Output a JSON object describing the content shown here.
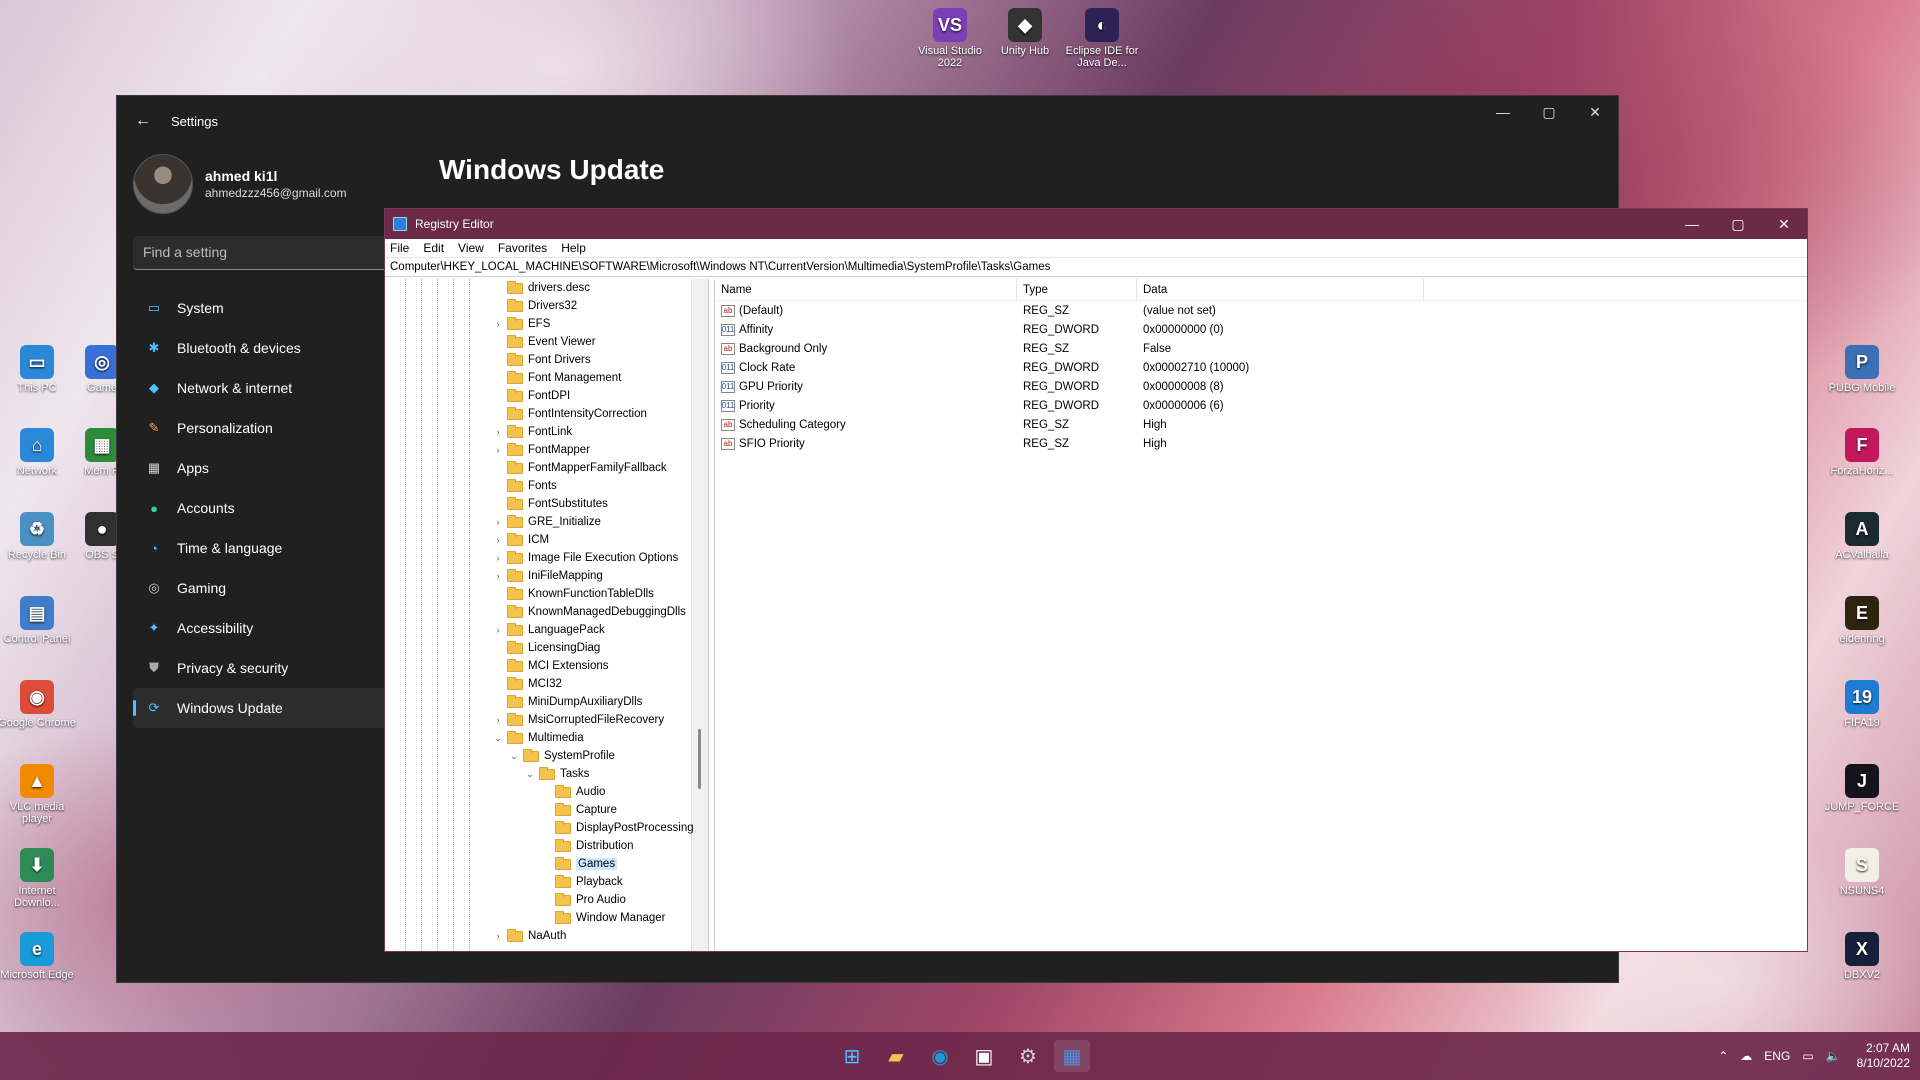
{
  "desktop": {
    "top_icons": [
      {
        "label": "Visual Studio 2022",
        "color": "#7b3fb8",
        "glyph": "VS"
      },
      {
        "label": "Unity Hub",
        "color": "#333333",
        "glyph": "◆"
      },
      {
        "label": "Eclipse IDE for Java De...",
        "color": "#2c2255",
        "glyph": "◐"
      }
    ],
    "left_icons": [
      {
        "label": "This PC",
        "color": "#2b88d8",
        "glyph": "▭"
      },
      {
        "label": "Game",
        "color": "#3a6fd8",
        "glyph": "◎"
      },
      {
        "label": "Network",
        "color": "#2b88d8",
        "glyph": "⌂"
      },
      {
        "label": "Mem R",
        "color": "#2e8b3a",
        "glyph": "▦"
      },
      {
        "label": "Recycle Bin",
        "color": "#4a90c2",
        "glyph": "♻"
      },
      {
        "label": "OBS S",
        "color": "#303030",
        "glyph": "●"
      },
      {
        "label": "Control Panel",
        "color": "#3f7cc9",
        "glyph": "▤"
      },
      {
        "label": "Google Chrome",
        "color": "#dd4b39",
        "glyph": "◉"
      },
      {
        "label": "VLC media player",
        "color": "#f08a00",
        "glyph": "▲"
      },
      {
        "label": "Internet Downlo...",
        "color": "#2e8b57",
        "glyph": "⬇"
      },
      {
        "label": "Microsoft Edge",
        "color": "#1a9bd7",
        "glyph": "e"
      }
    ],
    "right_icons": [
      {
        "label": "PUBG Mobile",
        "color": "#3b6fb6",
        "glyph": "P"
      },
      {
        "label": "ForzaHoriz...",
        "color": "#c2185b",
        "glyph": "F"
      },
      {
        "label": "ACValhalla",
        "color": "#1a2c2f",
        "glyph": "A"
      },
      {
        "label": "eldenring",
        "color": "#2d2410",
        "glyph": "E"
      },
      {
        "label": "FIFA19",
        "color": "#1f7bd1",
        "glyph": "19"
      },
      {
        "label": "JUMP_FORCE",
        "color": "#14141a",
        "glyph": "J"
      },
      {
        "label": "NSUNS4",
        "color": "#f2efe6",
        "glyph": "S"
      },
      {
        "label": "DBXV2",
        "color": "#15203a",
        "glyph": "X"
      }
    ]
  },
  "settings": {
    "title": "Settings",
    "user_name": "ahmed ki1l",
    "user_email": "ahmedzzz456@gmail.com",
    "search_placeholder": "Find a setting",
    "page_title": "Windows Update",
    "nav": [
      {
        "label": "System",
        "icon": "▭",
        "color": "#4cc2ff"
      },
      {
        "label": "Bluetooth & devices",
        "icon": "✱",
        "color": "#4cc2ff"
      },
      {
        "label": "Network & internet",
        "icon": "◆",
        "color": "#4cc2ff"
      },
      {
        "label": "Personalization",
        "icon": "✎",
        "color": "#e8a46b"
      },
      {
        "label": "Apps",
        "icon": "▦",
        "color": "#cfcfcf"
      },
      {
        "label": "Accounts",
        "icon": "●",
        "color": "#3fcf8e"
      },
      {
        "label": "Time & language",
        "icon": "◔",
        "color": "#4cc2ff"
      },
      {
        "label": "Gaming",
        "icon": "◎",
        "color": "#cfcfcf"
      },
      {
        "label": "Accessibility",
        "icon": "✦",
        "color": "#4cc2ff"
      },
      {
        "label": "Privacy & security",
        "icon": "⛊",
        "color": "#aaaaaa"
      },
      {
        "label": "Windows Update",
        "icon": "⟳",
        "color": "#4cc2ff"
      }
    ]
  },
  "regedit": {
    "title": "Registry Editor",
    "menu": [
      "File",
      "Edit",
      "View",
      "Favorites",
      "Help"
    ],
    "address": "Computer\\HKEY_LOCAL_MACHINE\\SOFTWARE\\Microsoft\\Windows NT\\CurrentVersion\\Multimedia\\SystemProfile\\Tasks\\Games",
    "tree": [
      {
        "label": "drivers.desc",
        "depth": 0,
        "exp": ""
      },
      {
        "label": "Drivers32",
        "depth": 0,
        "exp": ""
      },
      {
        "label": "EFS",
        "depth": 0,
        "exp": ">"
      },
      {
        "label": "Event Viewer",
        "depth": 0,
        "exp": ""
      },
      {
        "label": "Font Drivers",
        "depth": 0,
        "exp": ""
      },
      {
        "label": "Font Management",
        "depth": 0,
        "exp": ""
      },
      {
        "label": "FontDPI",
        "depth": 0,
        "exp": ""
      },
      {
        "label": "FontIntensityCorrection",
        "depth": 0,
        "exp": ""
      },
      {
        "label": "FontLink",
        "depth": 0,
        "exp": ">"
      },
      {
        "label": "FontMapper",
        "depth": 0,
        "exp": ">"
      },
      {
        "label": "FontMapperFamilyFallback",
        "depth": 0,
        "exp": ""
      },
      {
        "label": "Fonts",
        "depth": 0,
        "exp": ""
      },
      {
        "label": "FontSubstitutes",
        "depth": 0,
        "exp": ""
      },
      {
        "label": "GRE_Initialize",
        "depth": 0,
        "exp": ">"
      },
      {
        "label": "ICM",
        "depth": 0,
        "exp": ">"
      },
      {
        "label": "Image File Execution Options",
        "depth": 0,
        "exp": ">"
      },
      {
        "label": "IniFileMapping",
        "depth": 0,
        "exp": ">"
      },
      {
        "label": "KnownFunctionTableDlls",
        "depth": 0,
        "exp": ""
      },
      {
        "label": "KnownManagedDebuggingDlls",
        "depth": 0,
        "exp": ""
      },
      {
        "label": "LanguagePack",
        "depth": 0,
        "exp": ">"
      },
      {
        "label": "LicensingDiag",
        "depth": 0,
        "exp": ""
      },
      {
        "label": "MCI Extensions",
        "depth": 0,
        "exp": ""
      },
      {
        "label": "MCI32",
        "depth": 0,
        "exp": ""
      },
      {
        "label": "MiniDumpAuxiliaryDlls",
        "depth": 0,
        "exp": ""
      },
      {
        "label": "MsiCorruptedFileRecovery",
        "depth": 0,
        "exp": ">"
      },
      {
        "label": "Multimedia",
        "depth": 0,
        "exp": "v"
      },
      {
        "label": "SystemProfile",
        "depth": 1,
        "exp": "v"
      },
      {
        "label": "Tasks",
        "depth": 2,
        "exp": "v"
      },
      {
        "label": "Audio",
        "depth": 3,
        "exp": ""
      },
      {
        "label": "Capture",
        "depth": 3,
        "exp": ""
      },
      {
        "label": "DisplayPostProcessing",
        "depth": 3,
        "exp": ""
      },
      {
        "label": "Distribution",
        "depth": 3,
        "exp": ""
      },
      {
        "label": "Games",
        "depth": 3,
        "exp": "",
        "selected": true
      },
      {
        "label": "Playback",
        "depth": 3,
        "exp": ""
      },
      {
        "label": "Pro Audio",
        "depth": 3,
        "exp": ""
      },
      {
        "label": "Window Manager",
        "depth": 3,
        "exp": ""
      },
      {
        "label": "NaAuth",
        "depth": 0,
        "exp": ">"
      }
    ],
    "columns": {
      "name": "Name",
      "type": "Type",
      "data": "Data"
    },
    "values": [
      {
        "name": "(Default)",
        "type": "REG_SZ",
        "data": "(value not set)",
        "kind": "ab"
      },
      {
        "name": "Affinity",
        "type": "REG_DWORD",
        "data": "0x00000000 (0)",
        "kind": "bin"
      },
      {
        "name": "Background Only",
        "type": "REG_SZ",
        "data": "False",
        "kind": "ab"
      },
      {
        "name": "Clock Rate",
        "type": "REG_DWORD",
        "data": "0x00002710 (10000)",
        "kind": "bin"
      },
      {
        "name": "GPU Priority",
        "type": "REG_DWORD",
        "data": "0x00000008 (8)",
        "kind": "bin"
      },
      {
        "name": "Priority",
        "type": "REG_DWORD",
        "data": "0x00000006 (6)",
        "kind": "bin"
      },
      {
        "name": "Scheduling Category",
        "type": "REG_SZ",
        "data": "High",
        "kind": "ab"
      },
      {
        "name": "SFIO Priority",
        "type": "REG_SZ",
        "data": "High",
        "kind": "ab"
      }
    ]
  },
  "taskbar": {
    "apps": [
      {
        "name": "start-button",
        "glyph": "⊞",
        "color": "#4cc2ff"
      },
      {
        "name": "file-explorer-button",
        "glyph": "▰",
        "color": "#f3c34d"
      },
      {
        "name": "edge-button",
        "glyph": "◉",
        "color": "#1a9bd7"
      },
      {
        "name": "store-button",
        "glyph": "▣",
        "color": "#ffffff"
      },
      {
        "name": "settings-button",
        "glyph": "⚙",
        "color": "#d0d0d0"
      },
      {
        "name": "regedit-button",
        "glyph": "▦",
        "color": "#4c8fe0"
      }
    ],
    "language": "ENG",
    "time": "2:07 AM",
    "date": "8/10/2022"
  }
}
